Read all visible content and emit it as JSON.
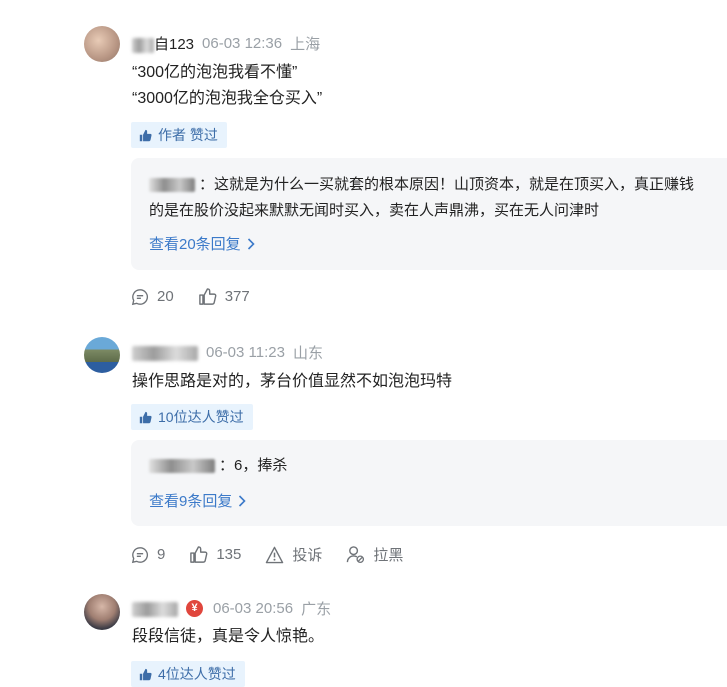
{
  "comments": [
    {
      "username": "自123",
      "time": "06-03 12:36",
      "location": "上海",
      "lines": [
        "“300亿的泡泡我看不懂”",
        "“3000亿的泡泡我全仓买入”"
      ],
      "badge": "作者 赞过",
      "reply_text_1": "：这就是为什么一买就套的根本原因！山顶资本，就是在顶买入，真正赚钱",
      "reply_text_2": "的是在股价没起来默默无闻时买入，卖在人声鼎沸，买在无人问津时",
      "view_replies": "查看20条回复",
      "reply_count": "20",
      "like_count": "377"
    },
    {
      "username": "",
      "time": "06-03 11:23",
      "location": "山东",
      "lines": [
        "操作思路是对的，茅台价值显然不如泡泡玛特"
      ],
      "badge": "10位达人赞过",
      "reply_text_1": "：6，捧杀",
      "view_replies": "查看9条回复",
      "reply_count": "9",
      "like_count": "135",
      "report_label": "投诉",
      "block_label": "拉黑"
    },
    {
      "username": "",
      "time": "06-03 20:56",
      "location": "广东",
      "lines": [
        "段段信徒，真是令人惊艳。"
      ],
      "badge": "4位达人赞过",
      "vip_symbol": "¥"
    }
  ],
  "icons": {
    "comment": "comment-bubble-icon",
    "like": "thumbs-up-icon",
    "report": "warning-icon",
    "block": "user-block-icon",
    "chevron": "chevron-right-icon"
  },
  "colors": {
    "link": "#3c7ac9",
    "badge_bg": "#e8f3fd",
    "badge_text": "#3d6da8",
    "reply_bg": "#f5f6f8",
    "meta_gray": "#9aa0a6",
    "vip_red": "#e0463d"
  }
}
